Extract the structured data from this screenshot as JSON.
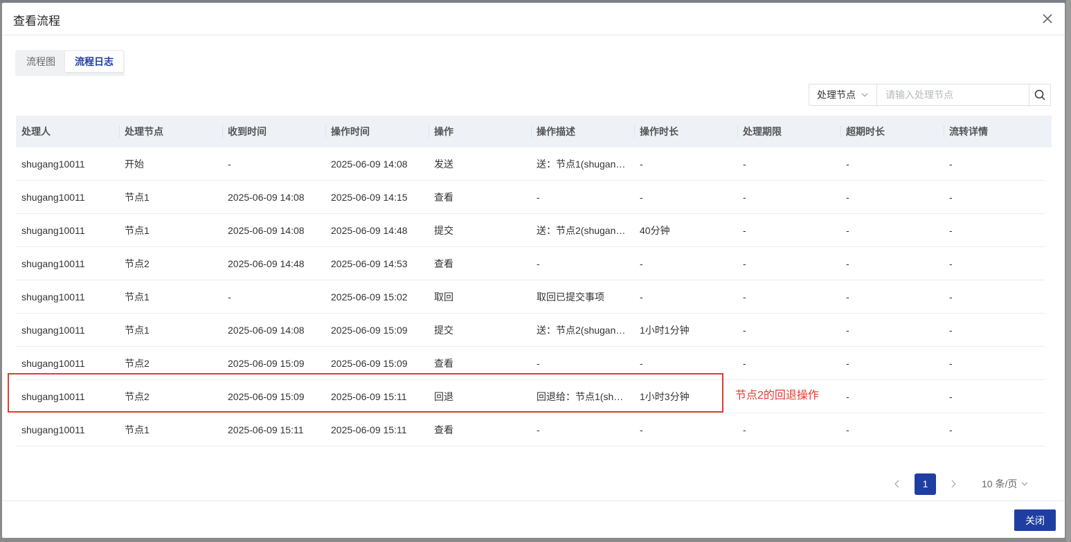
{
  "modal": {
    "title": "查看流程",
    "close_icon": "close-icon"
  },
  "tabs": [
    {
      "label": "流程图",
      "active": false
    },
    {
      "label": "流程日志",
      "active": true
    }
  ],
  "search": {
    "select_value": "处理节点",
    "placeholder": "请输入处理节点",
    "search_icon": "search-icon"
  },
  "table": {
    "headers": [
      "处理人",
      "处理节点",
      "收到时间",
      "操作时间",
      "操作",
      "操作描述",
      "操作时长",
      "处理期限",
      "超期时长",
      "流转详情"
    ],
    "rows": [
      [
        "shugang10011",
        "开始",
        "-",
        "2025-06-09 14:08",
        "发送",
        "送：节点1(shugan…",
        "-",
        "-",
        "-",
        "-"
      ],
      [
        "shugang10011",
        "节点1",
        "2025-06-09 14:08",
        "2025-06-09 14:15",
        "查看",
        "-",
        "-",
        "-",
        "-",
        "-"
      ],
      [
        "shugang10011",
        "节点1",
        "2025-06-09 14:08",
        "2025-06-09 14:48",
        "提交",
        "送：节点2(shugan…",
        "40分钟",
        "-",
        "-",
        "-"
      ],
      [
        "shugang10011",
        "节点2",
        "2025-06-09 14:48",
        "2025-06-09 14:53",
        "查看",
        "-",
        "-",
        "-",
        "-",
        "-"
      ],
      [
        "shugang10011",
        "节点1",
        "-",
        "2025-06-09 15:02",
        "取回",
        "取回已提交事项",
        "-",
        "-",
        "-",
        "-"
      ],
      [
        "shugang10011",
        "节点1",
        "2025-06-09 14:08",
        "2025-06-09 15:09",
        "提交",
        "送：节点2(shugan…",
        "1小时1分钟",
        "-",
        "-",
        "-"
      ],
      [
        "shugang10011",
        "节点2",
        "2025-06-09 15:09",
        "2025-06-09 15:09",
        "查看",
        "-",
        "-",
        "-",
        "-",
        "-"
      ],
      [
        "shugang10011",
        "节点2",
        "2025-06-09 15:09",
        "2025-06-09 15:11",
        "回退",
        "回退给：节点1(sh…",
        "1小时3分钟",
        "",
        "-",
        "-"
      ],
      [
        "shugang10011",
        "节点1",
        "2025-06-09 15:11",
        "2025-06-09 15:11",
        "查看",
        "-",
        "-",
        "-",
        "-",
        "-"
      ]
    ]
  },
  "annotation": {
    "text": "节点2的回退操作",
    "color": "#e53a2f"
  },
  "pagination": {
    "current_page": "1",
    "page_size": "10 条/页"
  },
  "footer": {
    "close_label": "关闭"
  },
  "colors": {
    "primary": "#1f3ea1",
    "header_bg": "#eef1f6",
    "annotation_red": "#e53a2f"
  }
}
